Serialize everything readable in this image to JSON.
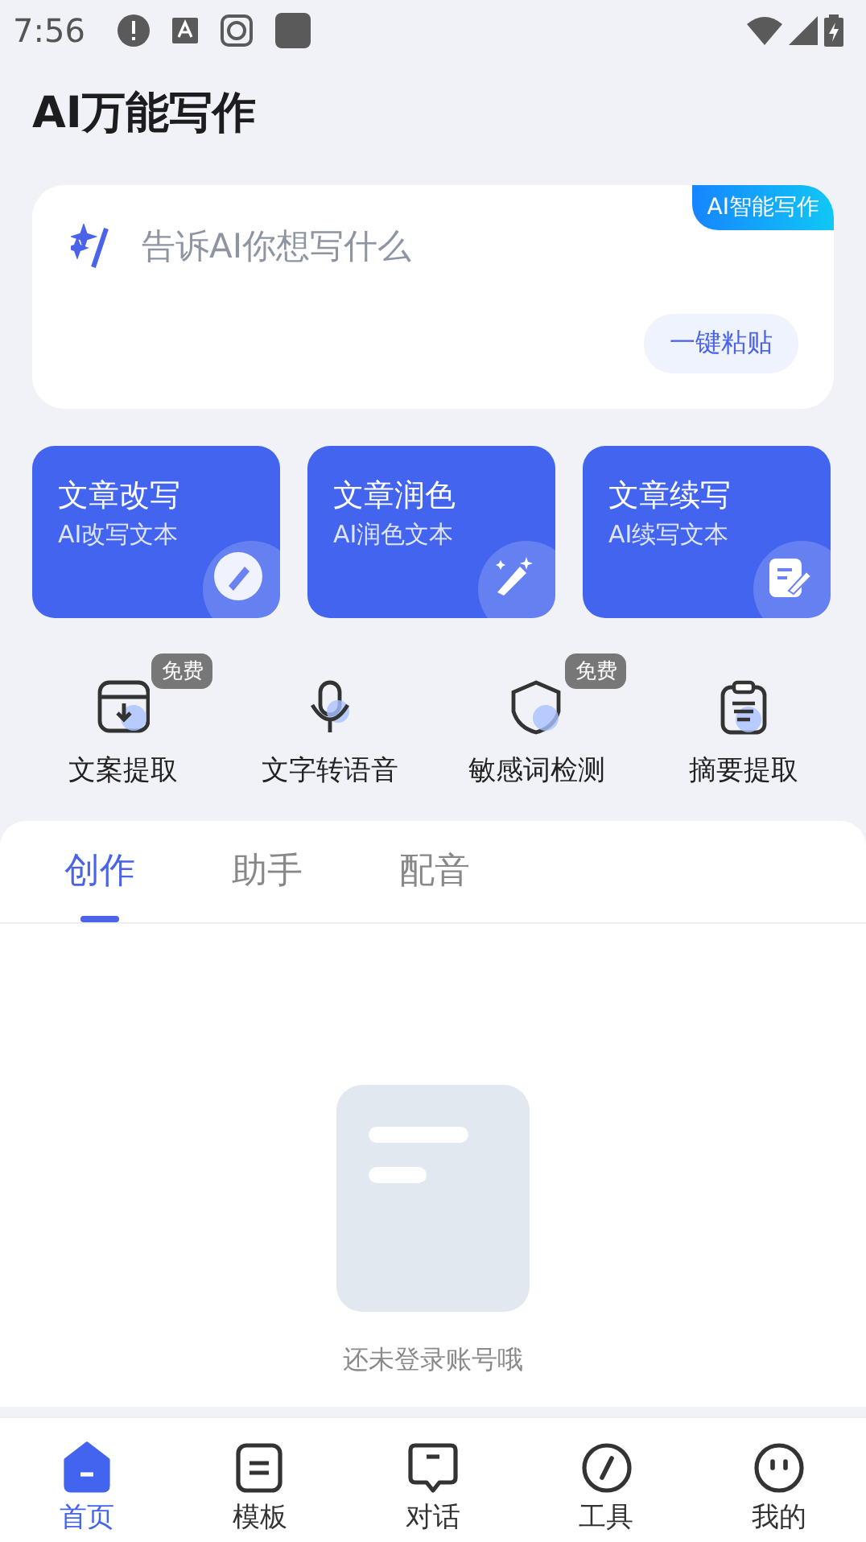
{
  "status_bar": {
    "time": "7:56"
  },
  "title": "AI万能写作",
  "prompt_card": {
    "badge": "AI智能写作",
    "placeholder": "告诉AI你想写什么",
    "paste_button": "一键粘贴"
  },
  "features": [
    {
      "title": "文章改写",
      "subtitle": "AI改写文本"
    },
    {
      "title": "文章润色",
      "subtitle": "AI润色文本"
    },
    {
      "title": "文章续写",
      "subtitle": "AI续写文本"
    }
  ],
  "tools": [
    {
      "label": "文案提取",
      "badge": "免费"
    },
    {
      "label": "文字转语音"
    },
    {
      "label": "敏感词检测",
      "badge": "免费"
    },
    {
      "label": "摘要提取"
    }
  ],
  "tabs": [
    {
      "label": "创作",
      "selected": true
    },
    {
      "label": "助手",
      "selected": false
    },
    {
      "label": "配音",
      "selected": false
    }
  ],
  "empty_state": {
    "message": "还未登录账号哦"
  },
  "bottom_nav": [
    {
      "label": "首页",
      "selected": true
    },
    {
      "label": "模板",
      "selected": false
    },
    {
      "label": "对话",
      "selected": false
    },
    {
      "label": "工具",
      "selected": false
    },
    {
      "label": "我的",
      "selected": false
    }
  ]
}
